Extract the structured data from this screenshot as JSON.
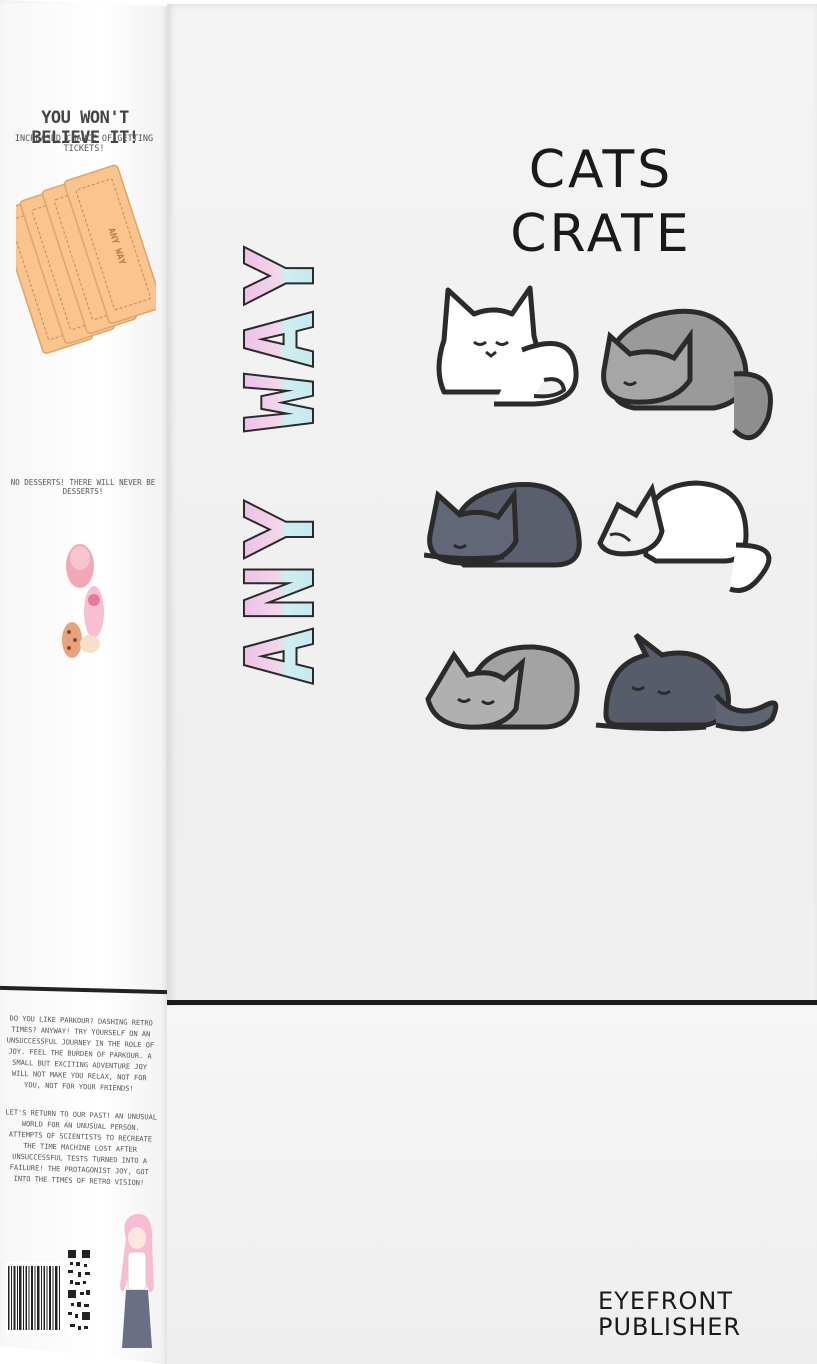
{
  "side_panel": {
    "headline": "YOU WON'T BELIEVE IT!",
    "subheadline": "INCREASED CHANCE OF GETTING TICKETS!",
    "ticket_text": "ANY WAY",
    "dessert_line": "NO DESSERTS! THERE WILL NEVER BE DESSERTS!",
    "description_1": "DO YOU LIKE PARKOUR? DASHING RETRO TIMES? ANYWAY! TRY YOURSELF ON AN UNSUCCESSFUL JOURNEY IN THE ROLE OF JOY. FEEL THE BURDEN OF PARKOUR. A SMALL BUT EXCITING ADVENTURE JOY WILL NOT MAKE YOU RELAX, NOT FOR YOU, NOT FOR YOUR FRIENDS!",
    "description_2": "LET'S RETURN TO OUR PAST! AN UNUSUAL WORLD FOR AN UNUSUAL PERSON. ATTEMPTS OF SCIENTISTS TO RECREATE THE TIME MACHINE LOST AFTER UNSUCCESSFUL TESTS TURNED INTO A FAILURE! THE PROTAGONIST JOY, GOT INTO THE TIMES OF RETRO VISION!"
  },
  "front_panel": {
    "logo": "ANY WAY",
    "product_title_line1": "CATS",
    "product_title_line2": "CRATE",
    "publisher_line1": "EYEFRONT",
    "publisher_line2": "PUBLISHER"
  },
  "cats": [
    {
      "color": "#ffffff"
    },
    {
      "color": "#9a9a9a"
    },
    {
      "color": "#5a5f6e"
    },
    {
      "color": "#ffffff"
    },
    {
      "color": "#a3a3a3"
    },
    {
      "color": "#575c6a"
    }
  ],
  "colors": {
    "logo_pink": "#e9b8e3",
    "logo_cyan": "#bfe8ee",
    "ticket_orange": "#f9c48e",
    "divider": "#1b1b1b"
  }
}
